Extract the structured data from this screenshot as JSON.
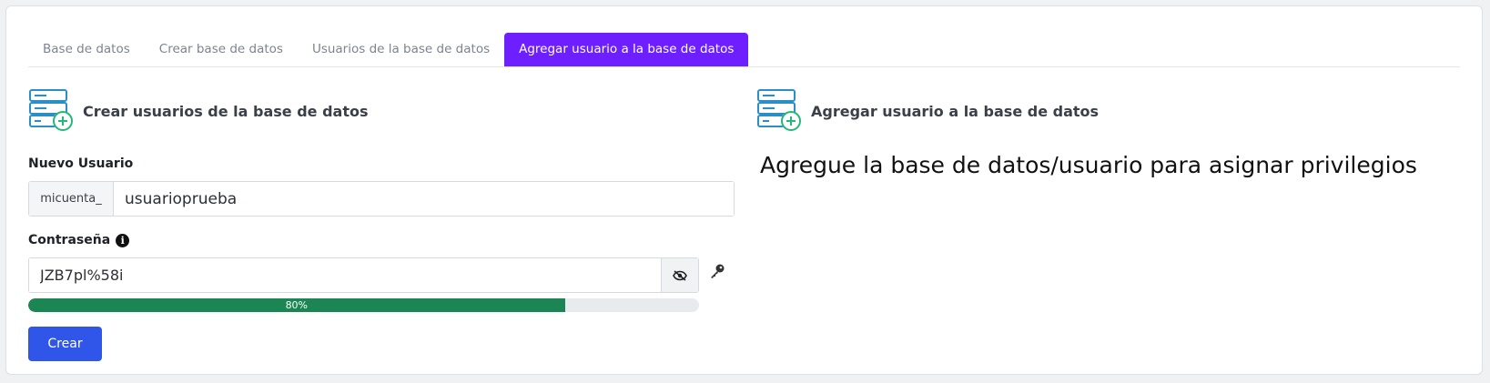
{
  "tabs": [
    {
      "label": "Base de datos"
    },
    {
      "label": "Crear base de datos"
    },
    {
      "label": "Usuarios de la base de datos"
    },
    {
      "label": "Agregar usuario a la base de datos",
      "active": true
    }
  ],
  "left": {
    "title": "Crear usuarios de la base de datos",
    "icon": "database-add-icon",
    "new_user_label": "Nuevo Usuario",
    "prefix": "micuenta_",
    "username_value": "usuarioprueba",
    "password_label": "Contraseña",
    "password_value": "JZB7pl%58i",
    "strength_percent": 80,
    "strength_text": "80%",
    "create_button": "Crear"
  },
  "right": {
    "title": "Agregar usuario a la base de datos",
    "icon": "database-add-icon",
    "message": "Agregue la base de datos/usuario para asignar privilegios"
  },
  "colors": {
    "accent": "#6d1fff",
    "primary_button": "#2f56e8",
    "progress": "#1b8553",
    "icon_blue": "#2a8fc7",
    "icon_green": "#25b87a"
  },
  "icons": {
    "info": "info-icon",
    "toggle_visibility": "eye-slash-icon",
    "generate": "key-icon"
  }
}
